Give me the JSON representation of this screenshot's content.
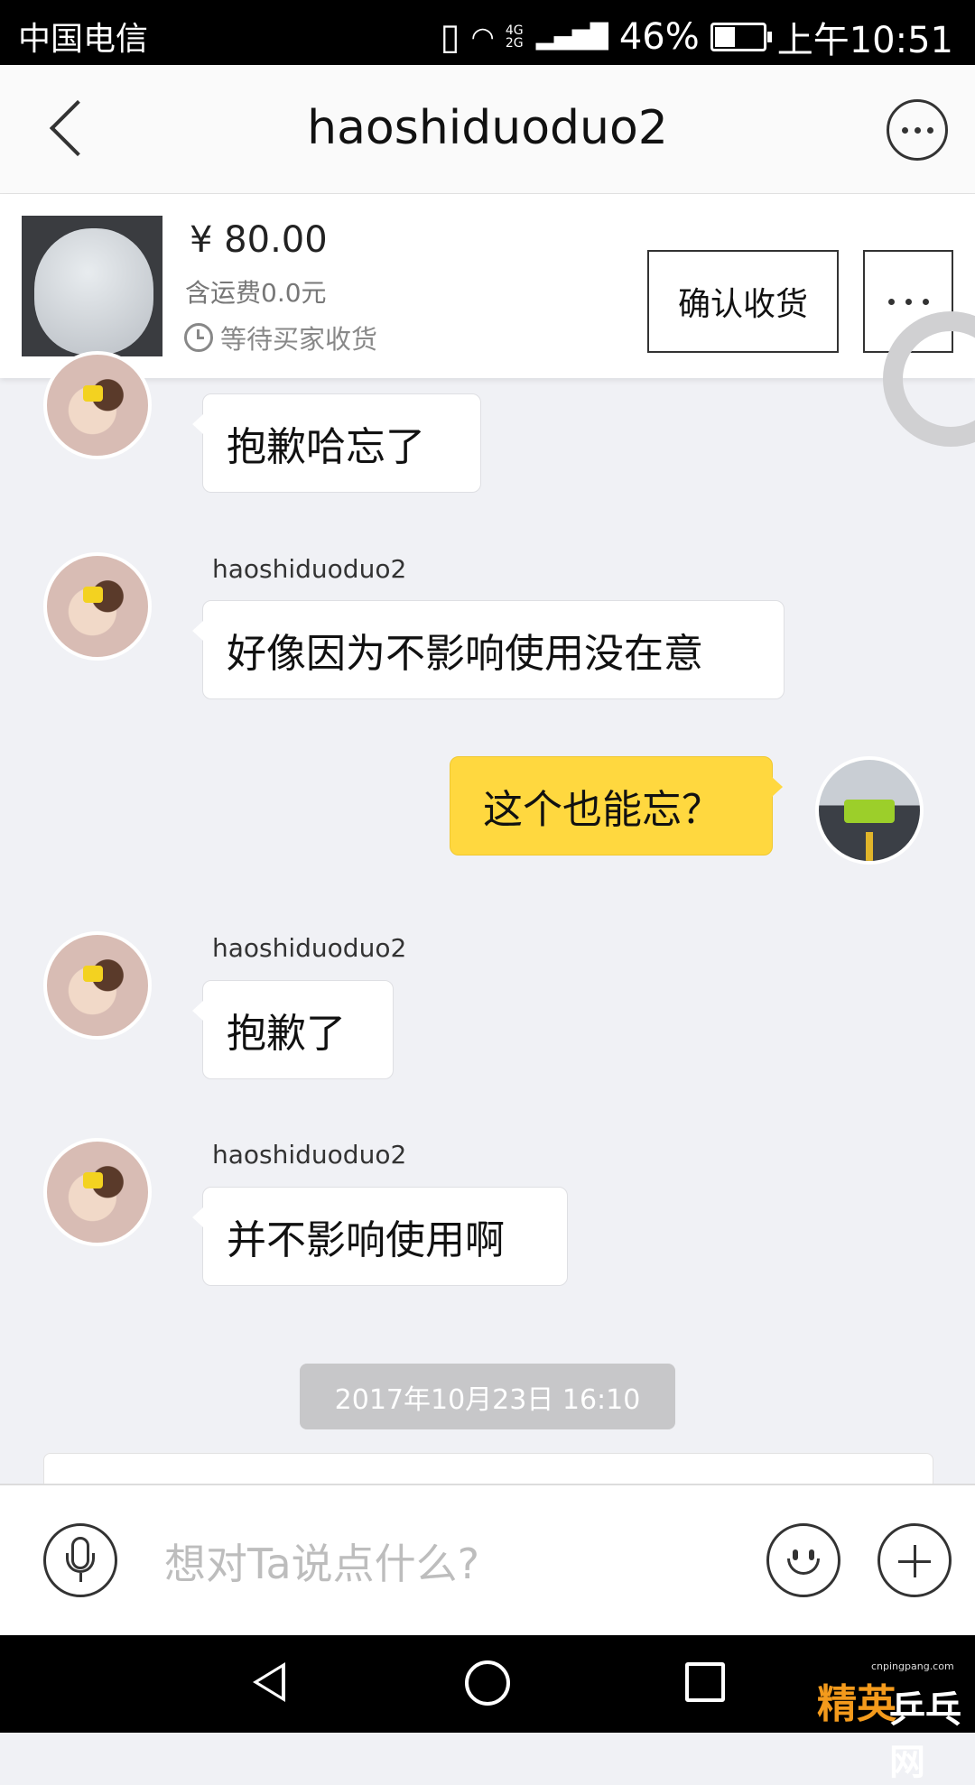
{
  "status_bar": {
    "carrier": "中国电信",
    "network": "4G 2G",
    "battery": "46%",
    "battery_level": 0.46,
    "time": "上午10:51"
  },
  "header": {
    "title": "haoshiduoduo2",
    "more_icon": "more-circle-icon"
  },
  "item": {
    "price": "¥ 80.00",
    "shipping": "含运费0.0元",
    "status": "等待买家收货",
    "confirm_label": "确认收货"
  },
  "messages": [
    {
      "from": "other",
      "sender": "",
      "text": "抱歉哈忘了"
    },
    {
      "from": "other",
      "sender": "haoshiduoduo2",
      "text": "好像因为不影响使用没在意"
    },
    {
      "from": "me",
      "sender": "",
      "text": "这个也能忘？"
    },
    {
      "from": "other",
      "sender": "haoshiduoduo2",
      "text": "抱歉了"
    },
    {
      "from": "other",
      "sender": "haoshiduoduo2",
      "text": "并不影响使用啊"
    }
  ],
  "timestamp": "2017年10月23日 16:10",
  "input": {
    "placeholder": "想对Ta说点什么?"
  },
  "watermark": {
    "text_a": "精英",
    "text_b": "乒乓网",
    "url": "cnpingpang.com"
  }
}
